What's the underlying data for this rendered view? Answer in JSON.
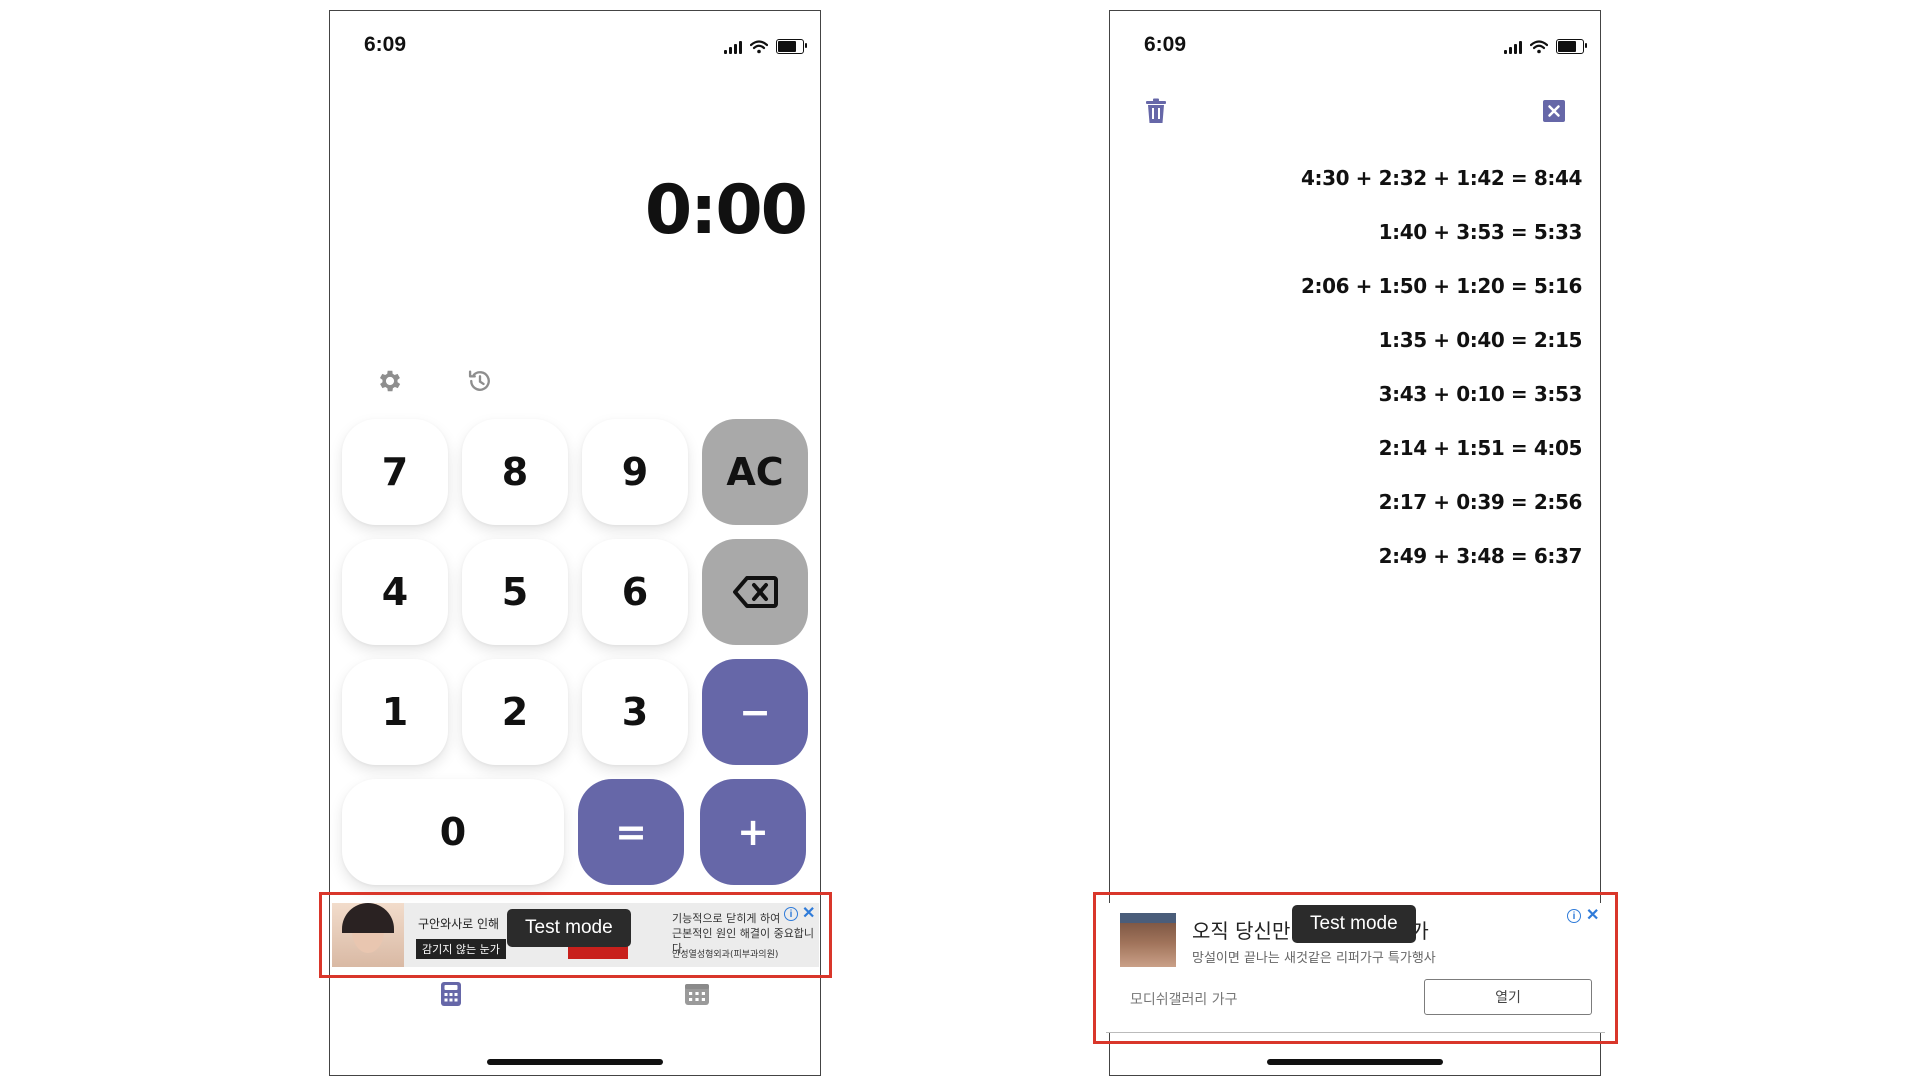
{
  "status_bar": {
    "time": "6:09"
  },
  "calculator": {
    "display": "0:00",
    "keys": {
      "seven": "7",
      "eight": "8",
      "nine": "9",
      "clear": "AC",
      "four": "4",
      "five": "5",
      "six": "6",
      "one": "1",
      "two": "2",
      "three": "3",
      "minus": "−",
      "zero": "0",
      "equals": "=",
      "plus": "+"
    }
  },
  "ad_left": {
    "headline": "구안와사로 인해",
    "pill": "감기지 않는 눈가",
    "side_text_line1": "기능적으로 닫히게 하여",
    "side_text_line2": "근본적인 원인 해결이 중요합니다.",
    "side_text_small": "안성열성형외과(피부과의원)",
    "info": "i",
    "close": "✕",
    "test_mode": "Test mode"
  },
  "history": {
    "entries": [
      "4:30 + 2:32 + 1:42 = 8:44",
      "1:40 + 3:53 = 5:33",
      "2:06 + 1:50 + 1:20 = 5:16",
      "1:35 + 0:40 = 2:15",
      "3:43 + 0:10 = 3:53",
      "2:14 + 1:51 = 4:05",
      "2:17 + 0:39 = 2:56",
      "2:49 + 3:48 = 6:37"
    ]
  },
  "ad_right": {
    "headline": "오직 당신만",
    "headline_tail": "가",
    "subtext": "망설이면 끝나는 새것같은 리퍼가구 특가행사",
    "advertiser": "모디쉬갤러리 가구",
    "open_button": "열기",
    "info": "i",
    "close": "✕",
    "test_mode": "Test mode"
  },
  "icons": {
    "settings": "gear-icon",
    "history": "history-icon",
    "backspace": "backspace-icon",
    "trash": "trash-icon",
    "close": "close-icon",
    "tab_calculator": "calculator-icon",
    "tab_calendar": "calendar-icon"
  },
  "colors": {
    "accent_purple": "#6667a8",
    "key_gray": "#a9a9a9",
    "ad_highlight_red": "#d9362a",
    "ad_info_blue": "#2f7bd9",
    "inactive_icon": "#9a9a9a"
  }
}
